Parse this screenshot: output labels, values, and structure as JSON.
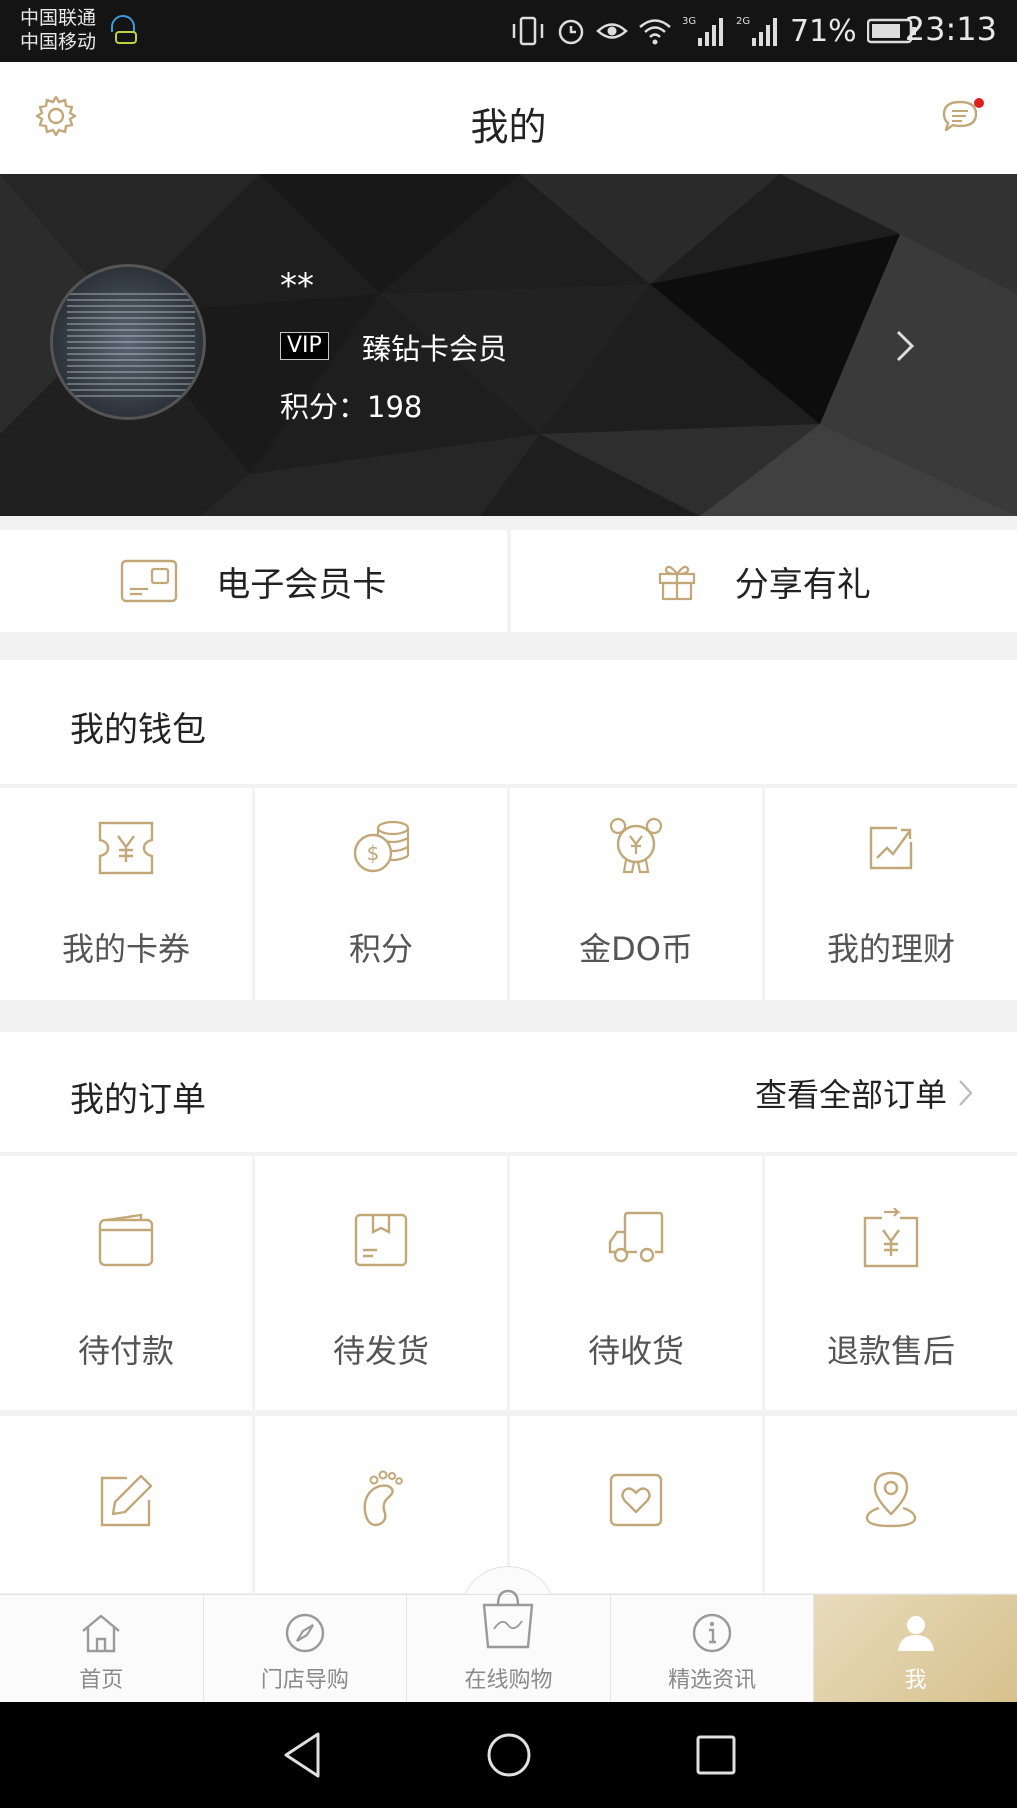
{
  "status_bar": {
    "carrier_1": "中国联通",
    "carrier_2": "中国移动",
    "network_1": "3G",
    "network_2": "2G",
    "battery": "71%",
    "time": "23:13"
  },
  "header": {
    "title": "我的"
  },
  "profile": {
    "nickname": "**",
    "vip_badge": "VIP",
    "member_level": "臻钻卡会员",
    "points_text": "积分：198"
  },
  "quick_actions": [
    {
      "label": "电子会员卡",
      "icon": "member-card-icon"
    },
    {
      "label": "分享有礼",
      "icon": "gift-icon"
    }
  ],
  "wallet": {
    "title": "我的钱包",
    "items": [
      {
        "label": "我的卡券",
        "icon": "coupon-icon"
      },
      {
        "label": "积分",
        "icon": "coins-icon"
      },
      {
        "label": "金DO币",
        "icon": "bear-coin-icon"
      },
      {
        "label": "我的理财",
        "icon": "finance-chart-icon"
      }
    ]
  },
  "orders": {
    "title": "我的订单",
    "view_all": "查看全部订单",
    "items": [
      {
        "label": "待付款",
        "icon": "wallet-icon"
      },
      {
        "label": "待发货",
        "icon": "package-icon"
      },
      {
        "label": "待收货",
        "icon": "truck-icon"
      },
      {
        "label": "退款售后",
        "icon": "refund-icon"
      }
    ],
    "items_row2": [
      {
        "icon": "edit-icon"
      },
      {
        "icon": "footprint-icon"
      },
      {
        "icon": "heart-icon"
      },
      {
        "icon": "location-icon"
      }
    ]
  },
  "tab_bar": [
    {
      "label": "首页",
      "icon": "home-icon"
    },
    {
      "label": "门店导购",
      "icon": "compass-icon"
    },
    {
      "label": "在线购物",
      "icon": "shopping-bag-icon"
    },
    {
      "label": "精选资讯",
      "icon": "info-icon"
    },
    {
      "label": "我",
      "icon": "user-icon",
      "active": true
    }
  ],
  "colors": {
    "accent_gold": "#c2a878",
    "dark_banner": "#1d1d1d",
    "red_dot": "#e0201e"
  }
}
